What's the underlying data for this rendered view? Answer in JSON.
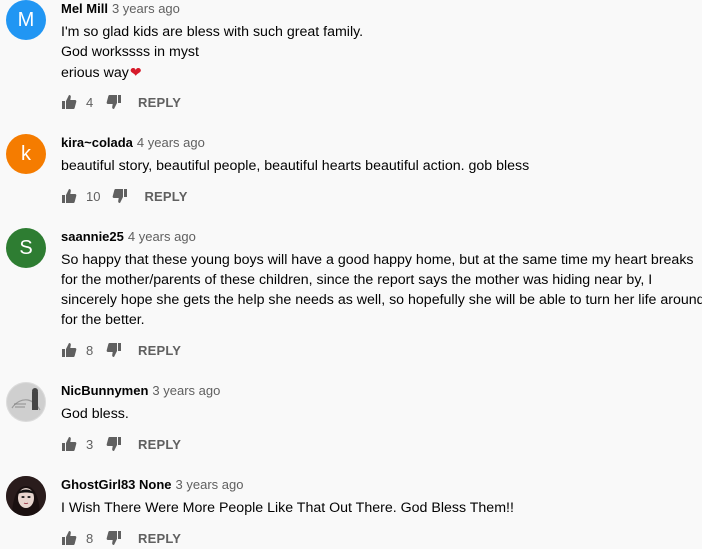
{
  "comments": [
    {
      "author": "Mel Mill",
      "time": "3 years ago",
      "avatar_letter": "M",
      "avatar_color": "#2196f3",
      "lines": [
        "I'm so glad kids are bless with such great family.",
        "God workssss in myst",
        "erious way"
      ],
      "emoji": "❤",
      "likes": "4",
      "reply_label": "REPLY"
    },
    {
      "author": "kira~colada",
      "time": "4 years ago",
      "avatar_letter": "k",
      "avatar_color": "#f57c00",
      "lines": [
        "beautiful story,  beautiful people, beautiful hearts  beautiful action. gob bless"
      ],
      "likes": "10",
      "reply_label": "REPLY"
    },
    {
      "author": "saannie25",
      "time": "4 years ago",
      "avatar_letter": "S",
      "avatar_color": "#2e7d32",
      "lines": [
        "So happy that these young boys will have a good happy home, but at the same time my heart breaks",
        "for the mother/parents of these children, since the report says the mother was hiding near by, I",
        "sincerely hope she gets the help she needs as well, so hopefully she will be able to turn her life around",
        "for the better."
      ],
      "likes": "8",
      "reply_label": "REPLY"
    },
    {
      "author": "NicBunnymen",
      "time": "3 years ago",
      "avatar_color": "#cfcfcf",
      "lines": [
        "God bless."
      ],
      "likes": "3",
      "reply_label": "REPLY"
    },
    {
      "author": "GhostGirl83 None",
      "time": "3 years ago",
      "avatar_color": "#3a2a2a",
      "lines": [
        "I Wish There Were More People Like That Out There. God Bless Them!!"
      ],
      "likes": "8",
      "reply_label": "REPLY"
    }
  ],
  "icons": {
    "like": "thumbs-up-icon",
    "dislike": "thumbs-down-icon",
    "heart": "red-heart-emoji"
  }
}
